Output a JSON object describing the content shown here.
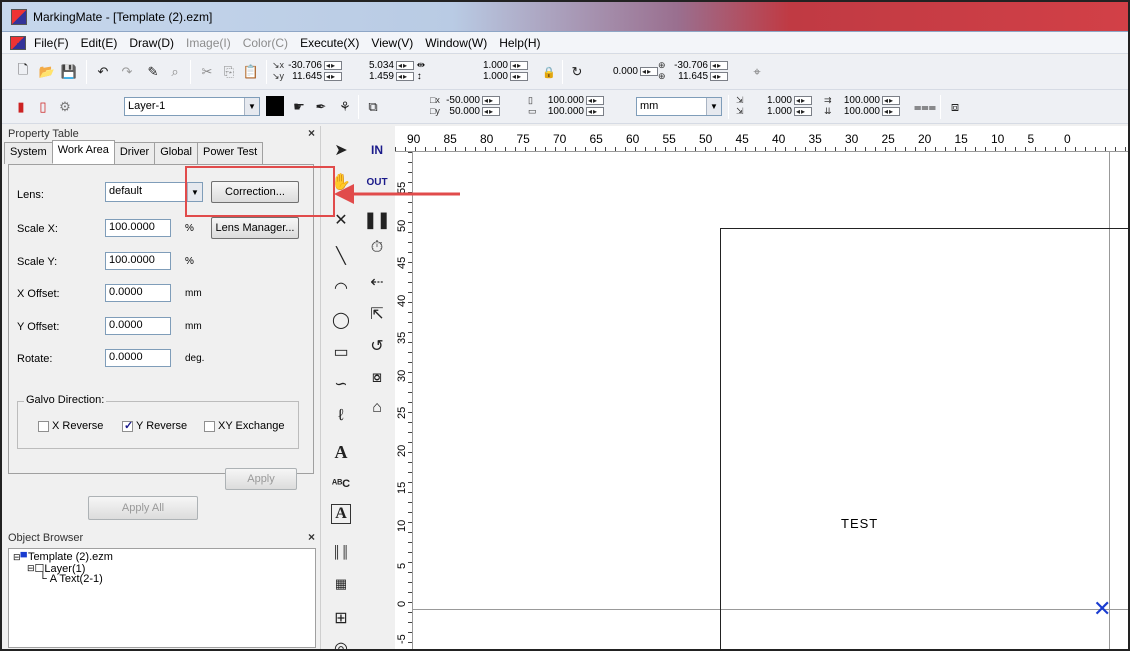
{
  "app": {
    "title": "MarkingMate - [Template (2).ezm]"
  },
  "menu": {
    "items": [
      {
        "label": "File(F)",
        "enabled": true
      },
      {
        "label": "Edit(E)",
        "enabled": true
      },
      {
        "label": "Draw(D)",
        "enabled": true
      },
      {
        "label": "Image(I)",
        "enabled": false
      },
      {
        "label": "Color(C)",
        "enabled": false
      },
      {
        "label": "Execute(X)",
        "enabled": true
      },
      {
        "label": "View(V)",
        "enabled": true
      },
      {
        "label": "Window(W)",
        "enabled": true
      },
      {
        "label": "Help(H)",
        "enabled": true
      }
    ]
  },
  "toolbar1": {
    "pos_x": "-30.706",
    "pos_y": "11.645",
    "width": "5.034",
    "height": "1.459",
    "scale_x": "1.000",
    "scale_y": "1.000",
    "rotate": "0.000",
    "center_x": "-30.706",
    "center_y": "11.645"
  },
  "toolbar2": {
    "layer": "Layer-1",
    "offset_x": "-50.000",
    "offset_y": "50.000",
    "pct_w": "100.000",
    "pct_h": "100.000",
    "unit": "mm",
    "dup_x": "1.000",
    "dup_y": "1.000",
    "array_x": "100.000",
    "array_y": "100.000"
  },
  "property_table": {
    "title": "Property Table",
    "tabs": [
      "System",
      "Work Area",
      "Driver",
      "Global",
      "Power Test"
    ],
    "active_tab": "Work Area",
    "lens_label": "Lens:",
    "lens_value": "default",
    "correction_button": "Correction...",
    "scale_x_label": "Scale X:",
    "scale_x_value": "100.0000",
    "scale_x_unit": "%",
    "lens_manager_button": "Lens Manager...",
    "scale_y_label": "Scale Y:",
    "scale_y_value": "100.0000",
    "scale_y_unit": "%",
    "x_offset_label": "X Offset:",
    "x_offset_value": "0.0000",
    "x_offset_unit": "mm",
    "y_offset_label": "Y Offset:",
    "y_offset_value": "0.0000",
    "y_offset_unit": "mm",
    "rotate_label": "Rotate:",
    "rotate_value": "0.0000",
    "rotate_unit": "deg.",
    "galvo_group": "Galvo Direction:",
    "x_reverse": "X Reverse",
    "y_reverse": "Y Reverse",
    "xy_exchange": "XY Exchange",
    "apply_button": "Apply",
    "apply_all_button": "Apply All"
  },
  "object_browser": {
    "title": "Object Browser",
    "root": "Template (2).ezm",
    "layer": "Layer(1)",
    "text_obj": "A Text(2-1)"
  },
  "marking_bar": {
    "in_label": "IN",
    "out_label": "OUT"
  },
  "canvas": {
    "h_ticks": [
      "90",
      "85",
      "80",
      "75",
      "70",
      "65",
      "60",
      "55",
      "50",
      "45",
      "40",
      "35",
      "30",
      "25",
      "20",
      "15",
      "10",
      "5",
      "0"
    ],
    "v_ticks": [
      "55",
      "50",
      "45",
      "40",
      "35",
      "30",
      "25",
      "20",
      "15",
      "10",
      "5",
      "0",
      "-5"
    ],
    "text_object": "TEST"
  },
  "colors": {
    "annotation_red": "#e14b4b",
    "origin_blue": "#1a3cd0"
  }
}
